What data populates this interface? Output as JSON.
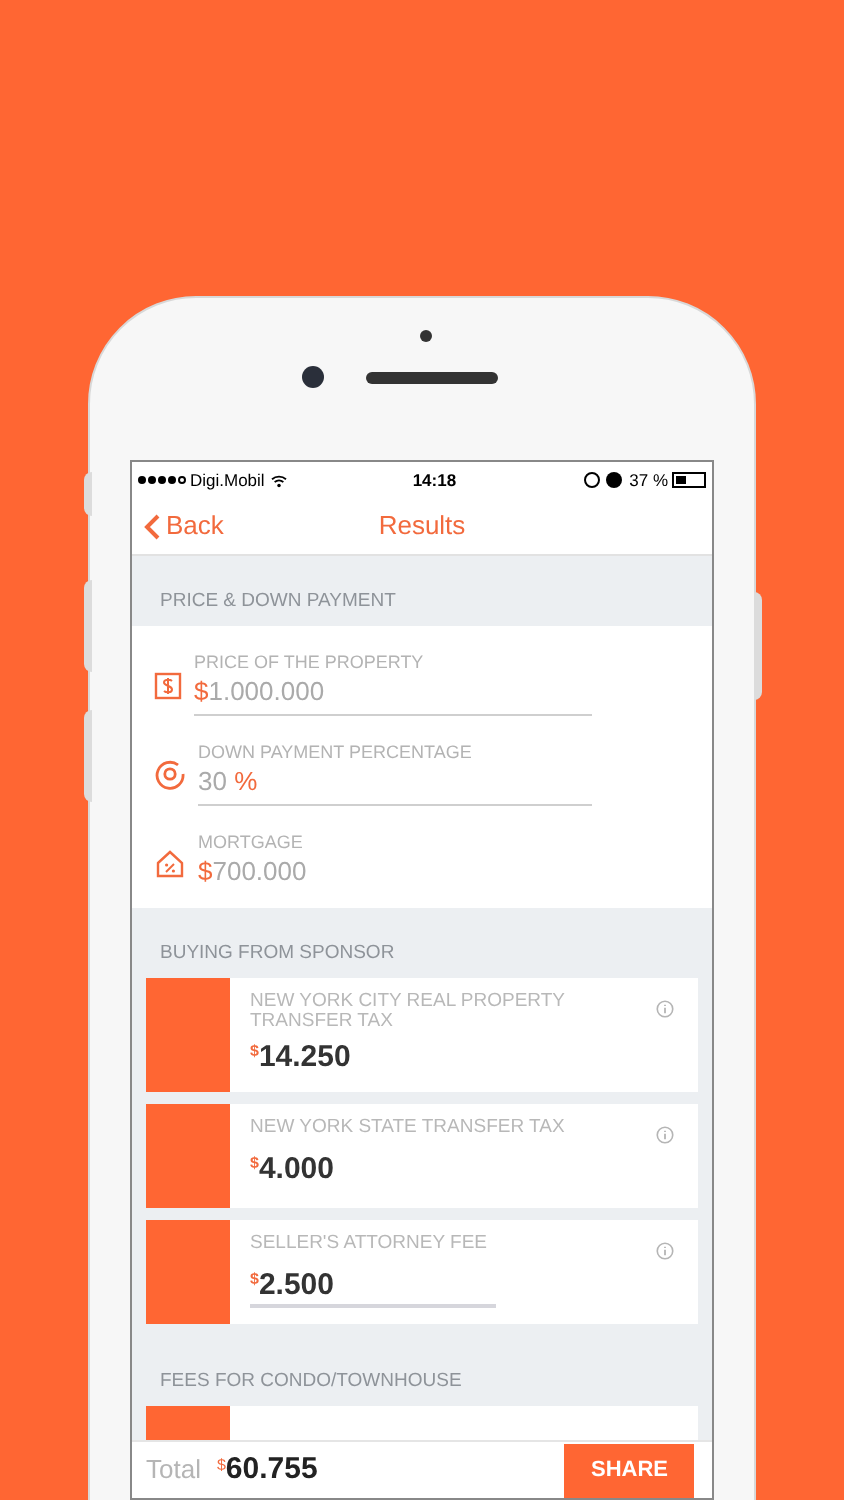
{
  "status_bar": {
    "carrier": "Digi.Mobil",
    "time": "14:18",
    "battery": "37 %"
  },
  "nav": {
    "back": "Back",
    "title": "Results"
  },
  "sections": [
    {
      "title": "PRICE & DOWN PAYMENT",
      "kind": "fields",
      "fields": [
        {
          "label": "PRICE OF THE PROPERTY",
          "prefix": "$",
          "value": "1.000.000",
          "editable": true
        },
        {
          "label": "DOWN PAYMENT PERCENTAGE",
          "value": "30 ",
          "suffix": "%",
          "editable": true
        },
        {
          "label": "MORTGAGE",
          "prefix": "$",
          "value": "700.000",
          "editable": false
        }
      ]
    },
    {
      "title": "BUYING FROM SPONSOR",
      "kind": "cards",
      "cards": [
        {
          "label": "NEW YORK CITY REAL PROPERTY TRANSFER TAX",
          "currency": "$",
          "amount": "14.250",
          "editable": false
        },
        {
          "label": "NEW YORK STATE TRANSFER TAX",
          "currency": "$",
          "amount": "4.000",
          "editable": false
        },
        {
          "label": "SELLER'S ATTORNEY FEE",
          "currency": "$",
          "amount": "2.500",
          "editable": true
        }
      ]
    },
    {
      "title": "FEES FOR CONDO/TOWNHOUSE",
      "kind": "cut"
    }
  ],
  "total": {
    "label": "Total",
    "currency": "$",
    "amount": "60.755",
    "button": "SHARE"
  }
}
